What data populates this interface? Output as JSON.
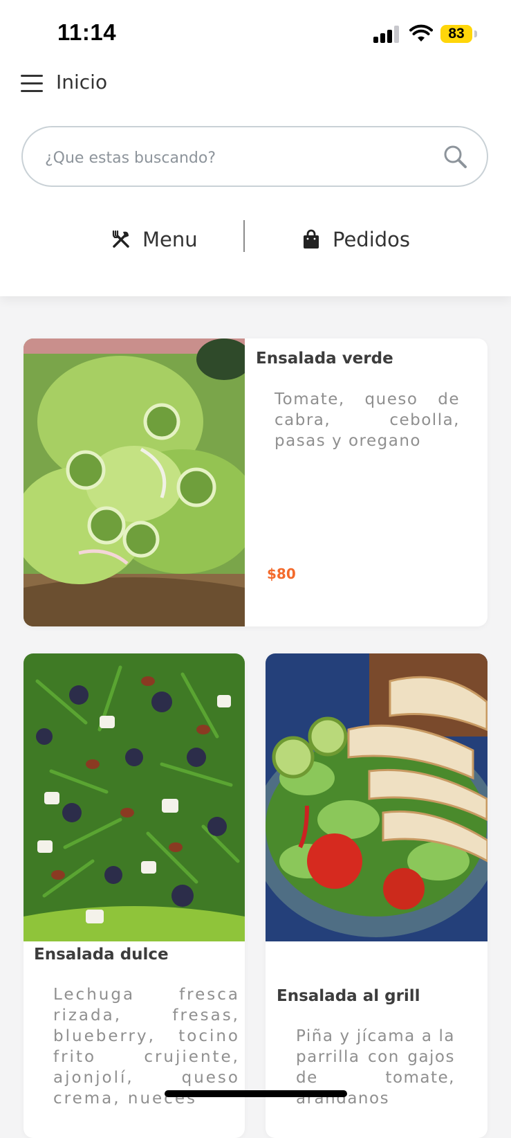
{
  "status_bar": {
    "time": "11:14",
    "battery": "83",
    "battery_color": "#ffd60a",
    "icons": [
      "cellular-signal-icon",
      "wifi-icon",
      "battery-icon"
    ]
  },
  "header": {
    "title": "Inicio",
    "menu_icon": "hamburger-menu-icon"
  },
  "search": {
    "placeholder": "¿Que estas buscando?",
    "icon": "search-icon"
  },
  "tabs": [
    {
      "label": "Menu",
      "icon": "fork-knife-icon"
    },
    {
      "label": "Pedidos",
      "icon": "shopping-bag-icon"
    }
  ],
  "theme": {
    "price_color": "#f36a2c",
    "background": "#f4f4f5"
  },
  "items": [
    {
      "name": "Ensalada verde",
      "description": "Tomate, queso de cabra, cebolla, pasas y oregano",
      "price": "$80",
      "image": "green-salad-photo"
    },
    {
      "name": "Ensalada dulce",
      "description": "Lechuga fresca rizada, fresas, blueberry, tocino frito crujiente, ajonjolí, queso crema, nueces",
      "image": "sweet-salad-photo"
    },
    {
      "name": "Ensalada al grill",
      "description": "Piña y jícama a la parrilla con gajos de tomate, arándanos",
      "image": "grilled-chicken-salad-photo"
    }
  ]
}
